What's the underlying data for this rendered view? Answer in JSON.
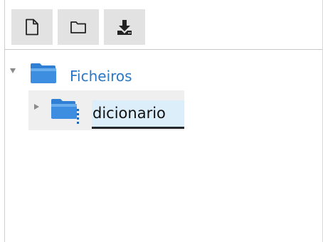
{
  "toolbar": {
    "buttons": [
      {
        "name": "new-file-button",
        "icon": "file-icon"
      },
      {
        "name": "new-folder-button",
        "icon": "folder-icon"
      },
      {
        "name": "download-button",
        "icon": "download-icon"
      }
    ]
  },
  "tree": {
    "root": {
      "label": "Ficheiros",
      "expanded": true,
      "icon": "folder-icon",
      "children": [
        {
          "label": "dicionario",
          "expanded": false,
          "selected": true,
          "icon": "folder-icon"
        }
      ]
    }
  },
  "colors": {
    "toolbar_button_bg": "#e2e2e2",
    "folder_blue": "#3d8de0",
    "root_label": "#2a77c5",
    "selection_bg": "#ddeefb",
    "row_highlight": "#efefef"
  }
}
